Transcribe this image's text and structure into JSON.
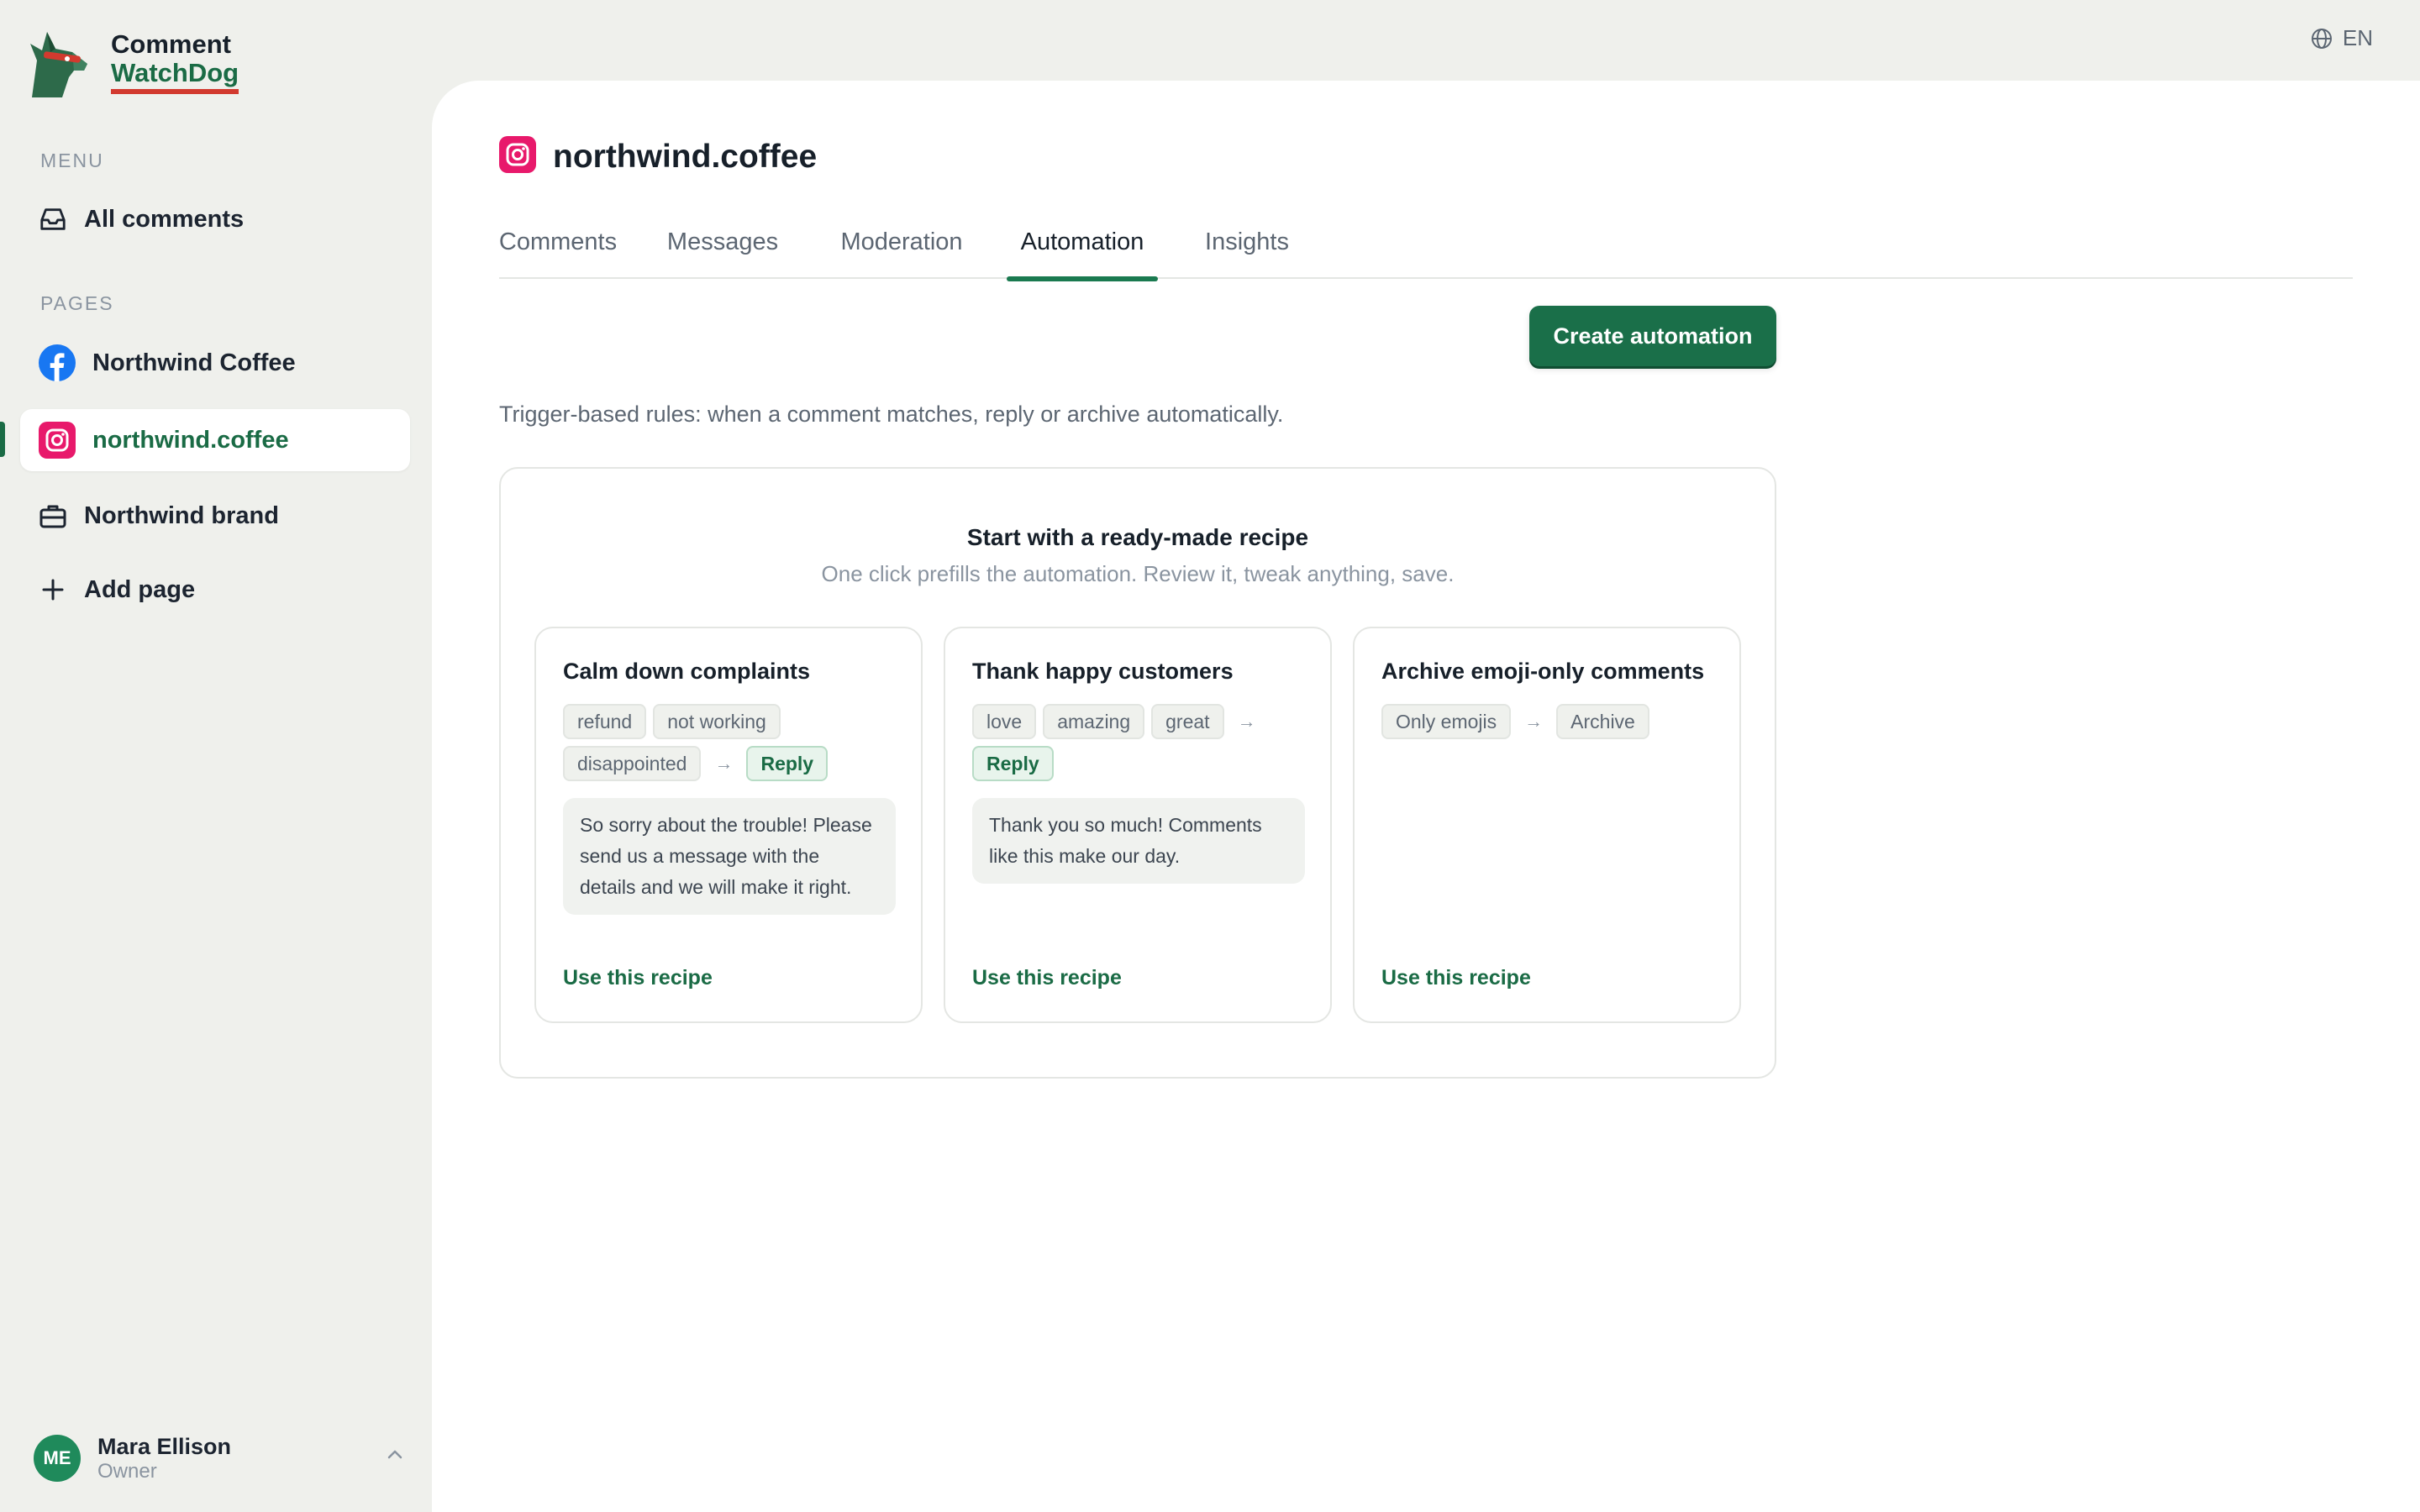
{
  "app": {
    "logo_line1": "Comment",
    "logo_line2": "WatchDog"
  },
  "sidebar": {
    "menu_label": "MENU",
    "all_comments": "All comments",
    "pages_label": "PAGES",
    "pages": [
      {
        "label": "Northwind Coffee",
        "icon": "facebook-icon"
      },
      {
        "label": "northwind.coffee",
        "icon": "instagram-icon",
        "active": true
      },
      {
        "label": "Northwind brand",
        "icon": "briefcase-icon"
      }
    ],
    "add_page": "Add page"
  },
  "user": {
    "initials": "ME",
    "name": "Mara Ellison",
    "role": "Owner"
  },
  "language": "EN",
  "page": {
    "title": "northwind.coffee",
    "platform_icon": "instagram-icon"
  },
  "tabs": [
    {
      "label": "Comments"
    },
    {
      "label": "Messages"
    },
    {
      "label": "Moderation"
    },
    {
      "label": "Automation",
      "active": true
    },
    {
      "label": "Insights"
    }
  ],
  "automation": {
    "description": "Trigger-based rules: when a comment matches, reply or archive automatically.",
    "create_button": "Create automation",
    "recipes_title": "Start with a ready-made recipe",
    "recipes_subtitle": "One click prefills the automation. Review it, tweak anything, save.",
    "recipes": [
      {
        "title": "Calm down complaints",
        "keywords": [
          "refund",
          "not working",
          "disappointed"
        ],
        "action": "Reply",
        "reply": "So sorry about the trouble! Please send us a message with the details and we will make it right.",
        "link": "Use this recipe"
      },
      {
        "title": "Thank happy customers",
        "keywords": [
          "love",
          "amazing",
          "great"
        ],
        "action": "Reply",
        "reply": "Thank you so much! Comments like this make our day.",
        "link": "Use this recipe"
      },
      {
        "title": "Archive emoji-only comments",
        "keywords": [
          "Only emojis"
        ],
        "action": "Archive",
        "link": "Use this recipe"
      }
    ]
  },
  "colors": {
    "brand_green": "#1a6b45",
    "button_green": "#1a6f49",
    "instagram_pink": "#e8196b",
    "facebook_blue": "#1877f2",
    "logo_underline": "#d23a2f"
  }
}
